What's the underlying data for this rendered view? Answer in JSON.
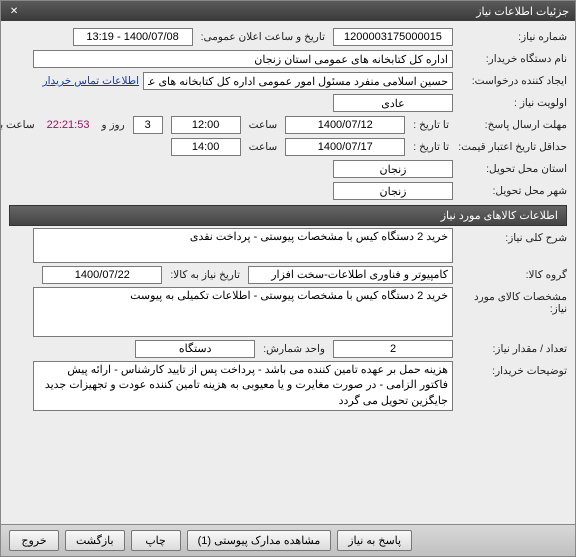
{
  "window": {
    "title": "جزئیات اطلاعات نیاز"
  },
  "s1": {
    "need_no_label": "شماره نیاز:",
    "need_no": "1200003175000015",
    "announce_label": "تاریخ و ساعت اعلان عمومی:",
    "announce": "1400/07/08 - 13:19",
    "buyer_label": "نام دستگاه خریدار:",
    "buyer": "اداره کل کتابخانه های عمومی استان زنجان",
    "requester_label": "ایجاد کننده درخواست:",
    "requester": "حسین اسلامی منفرد مسئول امور عمومی اداره کل کتابخانه های عمومی استان",
    "contact_link": "اطلاعات تماس خریدار",
    "priority_label": "اولویت نیاز :",
    "priority": "عادی",
    "deadline_label": "مهلت ارسال پاسخ:",
    "to_date_label": "تا تاریخ :",
    "deadline_date": "1400/07/12",
    "time_label": "ساعت",
    "deadline_time": "12:00",
    "days": "3",
    "days_label": "روز و",
    "timer": "22:21:53",
    "remain_label": "ساعت باقی مانده",
    "min_valid_label": "حداقل تاریخ اعتبار قیمت:",
    "valid_to_date": "1400/07/17",
    "valid_to_time": "14:00",
    "province_label": "استان محل تحویل:",
    "province": "زنجان",
    "city_label": "شهر محل تحویل:",
    "city": "زنجان"
  },
  "s2": {
    "header": "اطلاعات کالاهای مورد نیاز",
    "desc_label": "شرح کلی نیاز:",
    "desc": "خرید 2 دستگاه کیس با مشخصات پیوستی - پرداخت نقدی",
    "group_label": "گروه کالا:",
    "group": "کامپیوتر و فناوری اطلاعات-سخت افزار",
    "need_date_label": "تاریخ نیاز به کالا:",
    "need_date": "1400/07/22",
    "spec_label": "مشخصات کالای مورد نیاز:",
    "spec": "خرید 2 دستگاه کیس با مشخصات پیوستی - اطلاعات تکمیلی به پیوست",
    "qty_label": "تعداد / مقدار نیاز:",
    "qty": "2",
    "unit_label": "واحد شمارش:",
    "unit": "دستگاه",
    "notes_label": "توضیحات خریدار:",
    "notes": "هزینه حمل بر عهده تامین کننده می باشد - پرداخت پس از تایید کارشناس - ارائه پیش فاکتور الزامی - در صورت مغایرت و یا معیوبی به هزینه تامین کننده عودت و تجهیزات جدید جایگزین تحویل می گردد"
  },
  "buttons": {
    "exit": "خروج",
    "back": "بازگشت",
    "print": "چاپ",
    "attach": "مشاهده مدارک پیوستی (1)",
    "reply": "پاسخ به نیاز"
  }
}
